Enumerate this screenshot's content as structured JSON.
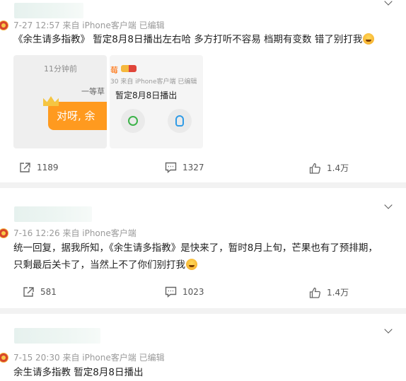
{
  "posts": [
    {
      "meta": "7-27 12:57  来自 iPhone客户端  已编辑",
      "text": "《余生请多指教》 暂定8月8日播出左右哈 多方打听不容易 档期有变数 错了别打我",
      "emoji": "laugh-emoji",
      "images": {
        "left": {
          "time": "11分钟前",
          "label": "一等草",
          "bubble": "对呀, 余"
        },
        "right": {
          "name": "莓",
          "meta": "30 来自 iPhone客户端 已编辑",
          "text": "暂定8月8日播出"
        }
      },
      "actions": {
        "repost": "1189",
        "comment": "1327",
        "like": "1.4万"
      }
    },
    {
      "meta": "7-16 12:26  来自 iPhone客户端",
      "text_line1": "统一回复，据我所知，《余生请多指教》是快来了，暂时8月上旬，芒果也有了预排期，",
      "text_line2": "只剩最后关卡了，当然上不了你们别打我",
      "emoji": "laugh-emoji",
      "actions": {
        "repost": "581",
        "comment": "1023",
        "like": "1.4万"
      }
    },
    {
      "meta": "7-15 20:30  来自 iPhone客户端  已编辑",
      "text": "余生请多指教 暂定8月8日播出"
    }
  ],
  "colors": {
    "orange": "#ff9a1f",
    "separator": "#f2f2f2",
    "meta": "#9a9a9a"
  }
}
